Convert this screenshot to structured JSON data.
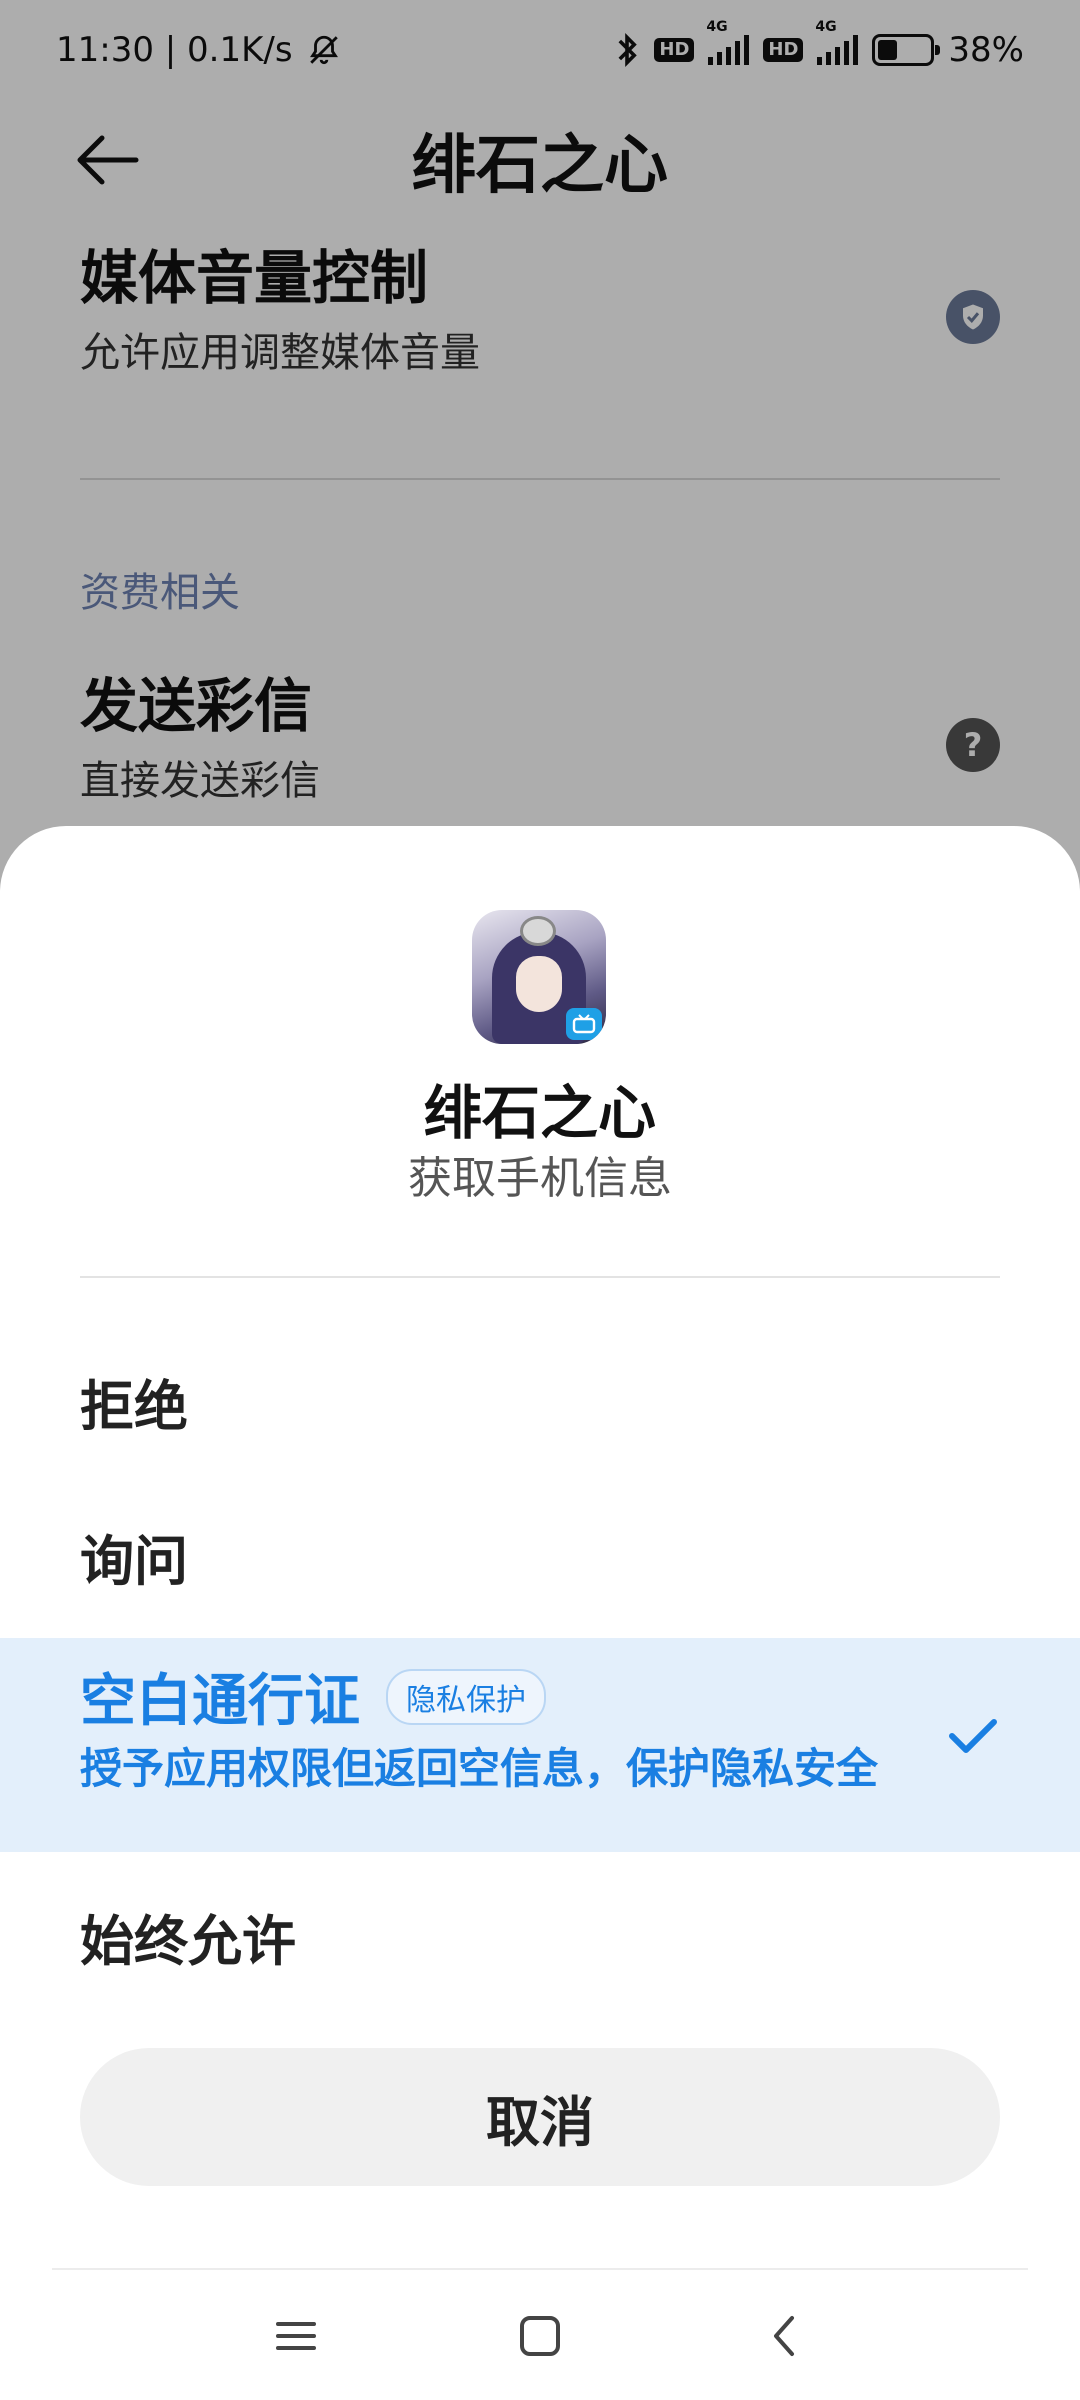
{
  "status_bar": {
    "time_speed": "11:30 | 0.1K/s",
    "hd1": "HD",
    "net1": "4G",
    "hd2": "HD",
    "net2": "4G",
    "battery_pct": "38%",
    "battery_level": 0.38
  },
  "page": {
    "title": "绯石之心",
    "items": [
      {
        "title": "媒体音量控制",
        "subtitle": "允许应用调整媒体音量"
      },
      {
        "title": "发送彩信",
        "subtitle": "直接发送彩信",
        "icon_text": "?"
      }
    ],
    "section_label": "资费相关"
  },
  "sheet": {
    "app_name": "绯石之心",
    "permission": "获取手机信息",
    "options": {
      "deny": "拒绝",
      "ask": "询问",
      "blank_pass": "空白通行证",
      "blank_pass_tag": "隐私保护",
      "blank_pass_desc": "授予应用权限但返回空信息，保护隐私安全",
      "always": "始终允许"
    },
    "selected": "blank_pass",
    "cancel": "取消"
  },
  "colors": {
    "accent": "#1a7fe2",
    "selected_bg": "#e3effb",
    "section_label": "#6d82b3"
  }
}
